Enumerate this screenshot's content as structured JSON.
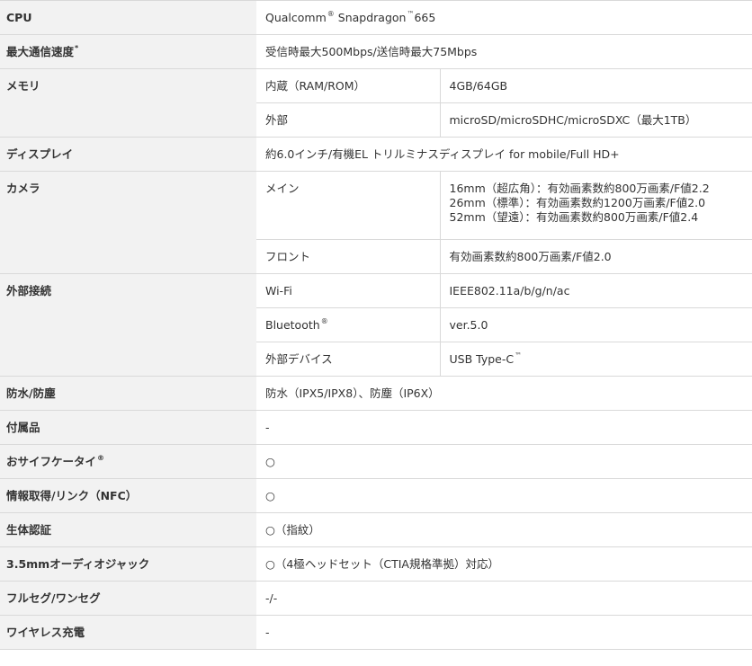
{
  "rows": {
    "cpu": {
      "label": "CPU",
      "value": "Qualcomm",
      "value_sup1": "®",
      "value_mid": "Snapdragon",
      "value_sup2": "™",
      "value_end": "665"
    },
    "speed": {
      "label": "最大通信速度",
      "label_sup": "*",
      "value": "受信時最大500Mbps/送信時最大75Mbps"
    },
    "memory": {
      "label": "メモリ",
      "internal_label": "内蔵（RAM/ROM）",
      "internal_value": "4GB/64GB",
      "external_label": "外部",
      "external_value": "microSD/microSDHC/microSDXC（最大1TB）"
    },
    "display": {
      "label": "ディスプレイ",
      "value": "約6.0インチ/有機EL トリルミナスディスプレイ for mobile/Full HD+"
    },
    "camera": {
      "label": "カメラ",
      "main_label": "メイン",
      "main_lines": [
        "16mm（超広角）：有効画素数約800万画素/F値2.2",
        "26mm（標準）：有効画素数約1200万画素/F値2.0",
        "52mm（望遠）：有効画素数約800万画素/F値2.4"
      ],
      "front_label": "フロント",
      "front_value": "有効画素数約800万画素/F値2.0"
    },
    "connectivity": {
      "label": "外部接続",
      "wifi_label": "Wi-Fi",
      "wifi_value": "IEEE802.11a/b/g/n/ac",
      "bt_label": "Bluetooth",
      "bt_sup": "®",
      "bt_value": "ver.5.0",
      "device_label": "外部デバイス",
      "device_value": "USB Type-C",
      "device_sup": "™"
    },
    "water": {
      "label": "防水/防塵",
      "value": "防水（IPX5/IPX8）、防塵（IP6X）"
    },
    "accessories": {
      "label": "付属品",
      "value": "-"
    },
    "osaifu": {
      "label": "おサイフケータイ",
      "label_sup": "®",
      "value": "○"
    },
    "nfc": {
      "label": "情報取得/リンク（NFC）",
      "value": "○"
    },
    "biometric": {
      "label": "生体認証",
      "value": "○（指紋）"
    },
    "jack": {
      "label": "3.5mmオーディオジャック",
      "value": "○（4極ヘッドセット（CTIA規格準拠）対応）"
    },
    "tv": {
      "label": "フルセグ/ワンセグ",
      "value": "-/-"
    },
    "wireless": {
      "label": "ワイヤレス充電",
      "value": "-"
    }
  }
}
